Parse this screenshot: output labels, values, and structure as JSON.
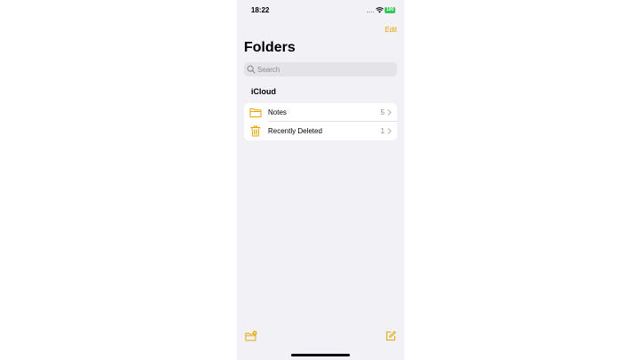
{
  "status_bar": {
    "time": "18:22",
    "battery": "100",
    "battery_color": "#34c759"
  },
  "nav": {
    "edit_label": "Edit",
    "title": "Folders"
  },
  "search": {
    "placeholder": "Search",
    "value": ""
  },
  "section": {
    "title": "iCloud"
  },
  "folders": [
    {
      "label": "Notes",
      "count": "5",
      "icon": "folder-icon"
    },
    {
      "label": "Recently Deleted",
      "count": "1",
      "icon": "trash-icon"
    }
  ],
  "toolbar": {
    "left_icon": "new-folder-icon",
    "right_icon": "compose-icon"
  },
  "colors": {
    "accent": "#e3a600",
    "background": "#f2f1f6",
    "secondary_text": "#8a8a8e"
  }
}
